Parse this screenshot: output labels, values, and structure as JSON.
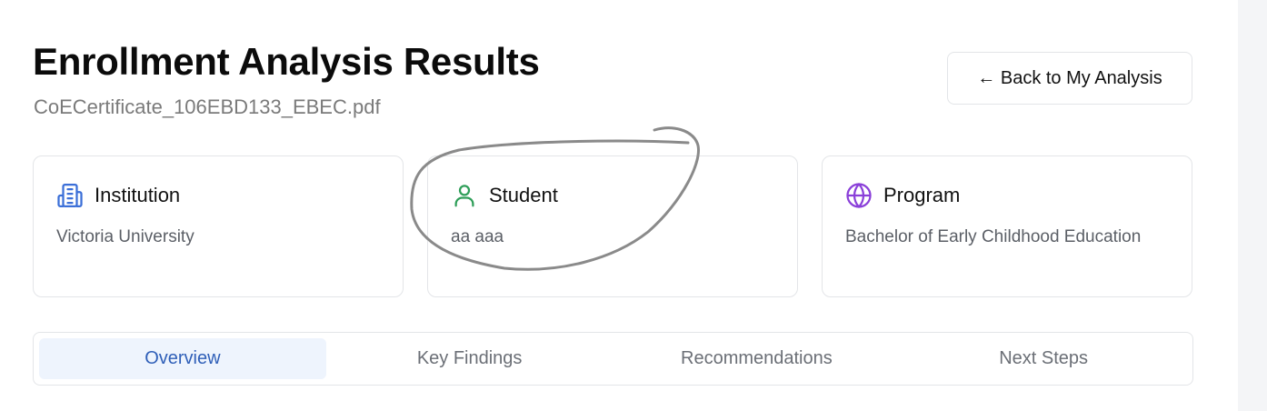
{
  "header": {
    "title": "Enrollment Analysis Results",
    "file_name": "CoECertificate_106EBD133_EBEC.pdf",
    "back_button_label": "← Back to My Analysis"
  },
  "cards": [
    {
      "title": "Institution",
      "value": "Victoria University",
      "icon": "building-icon",
      "icon_color": "#3b6fd8"
    },
    {
      "title": "Student",
      "value": "aa aaa",
      "icon": "user-icon",
      "icon_color": "#2e9e58"
    },
    {
      "title": "Program",
      "value": "Bachelor of Early Childhood Education",
      "icon": "globe-icon",
      "icon_color": "#8a3fd9"
    }
  ],
  "tabs": [
    {
      "label": "Overview",
      "active": true
    },
    {
      "label": "Key Findings",
      "active": false
    },
    {
      "label": "Recommendations",
      "active": false
    },
    {
      "label": "Next Steps",
      "active": false
    }
  ],
  "colors": {
    "active_tab_text": "#2f5fb8",
    "active_tab_bg": "#eef4fd",
    "annotation_stroke": "#8a8a8a"
  }
}
